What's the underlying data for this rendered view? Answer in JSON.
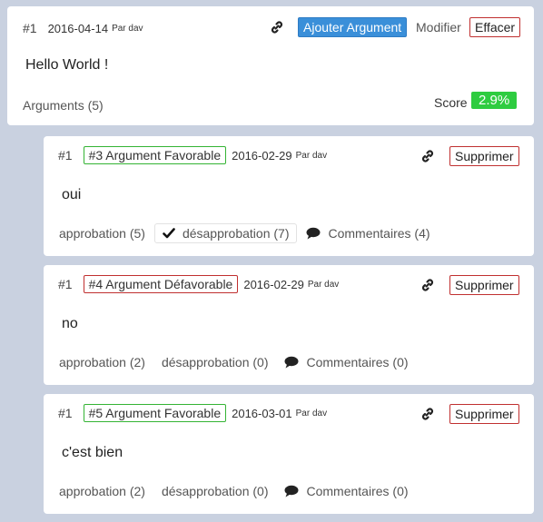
{
  "main": {
    "number": "#1",
    "date": "2016-04-14",
    "by": "Par dav",
    "add_argument_label": "Ajouter Argument",
    "edit_label": "Modifier",
    "delete_label": "Effacer",
    "body": "Hello World !",
    "arguments_label": "Arguments (5)",
    "score_label": "Score",
    "score_value": "2.9%"
  },
  "arguments": [
    {
      "number": "#1",
      "tag": "#3 Argument Favorable",
      "tag_type": "favorable",
      "date": "2016-02-29",
      "by": "Par dav",
      "delete_label": "Supprimer",
      "body": "oui",
      "approval": "approbation (5)",
      "disapproval": "désapprobation (7)",
      "disapproval_selected": true,
      "comments": "Commentaires (4)"
    },
    {
      "number": "#1",
      "tag": "#4 Argument Défavorable",
      "tag_type": "defavorable",
      "date": "2016-02-29",
      "by": "Par dav",
      "delete_label": "Supprimer",
      "body": "no",
      "approval": "approbation (2)",
      "disapproval": "désapprobation (0)",
      "disapproval_selected": false,
      "comments": "Commentaires (0)"
    },
    {
      "number": "#1",
      "tag": "#5 Argument Favorable",
      "tag_type": "favorable",
      "date": "2016-03-01",
      "by": "Par dav",
      "delete_label": "Supprimer",
      "body": "c'est bien",
      "approval": "approbation (2)",
      "disapproval": "désapprobation (0)",
      "disapproval_selected": false,
      "comments": "Commentaires (0)"
    }
  ],
  "colors": {
    "background": "#c9d1e0",
    "primary_button": "#3a8fd9",
    "danger_border": "#c03030",
    "favorable_border": "#34b434",
    "score_badge": "#2ecc40"
  },
  "icons": {
    "link": "link-icon",
    "check": "check-icon",
    "comment": "comment-bubble-icon"
  }
}
